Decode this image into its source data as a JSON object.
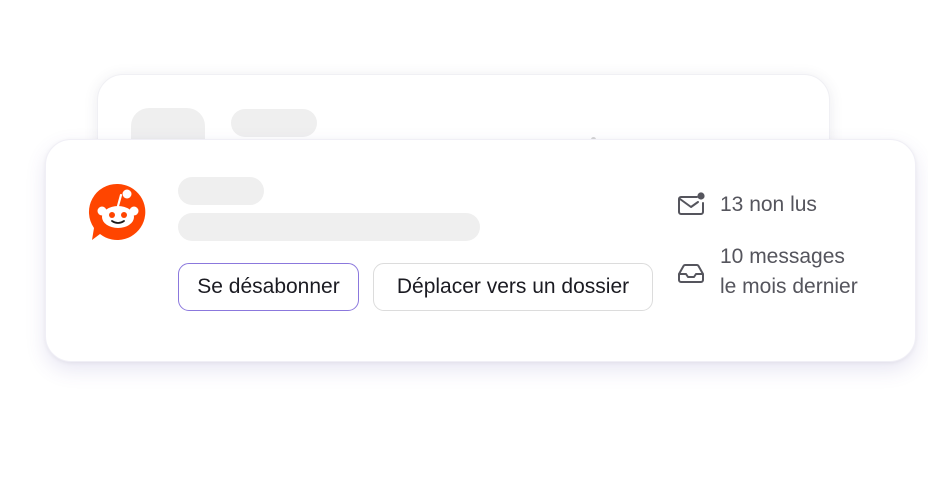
{
  "actions": {
    "unsubscribe_label": "Se désabonner",
    "move_to_folder_label": "Déplacer vers un dossier"
  },
  "stats": {
    "unread": "13 non lus",
    "monthly_line1": "10 messages",
    "monthly_line2": "le mois dernier"
  },
  "icons": {
    "logo": "reddit-logo",
    "unread": "mail-unread-icon",
    "monthly": "inbox-tray-icon"
  },
  "colors": {
    "brand": "#ff4500",
    "accent_border": "#8b78dd",
    "muted_text": "#55555d",
    "skeleton": "#efefef"
  }
}
